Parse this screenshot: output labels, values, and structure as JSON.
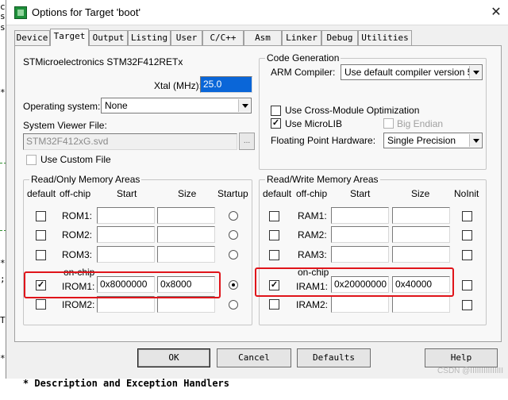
{
  "window": {
    "title": "Options for Target 'boot'",
    "close_glyph": "✕"
  },
  "tabs": [
    "Device",
    "Target",
    "Output",
    "Listing",
    "User",
    "C/C++",
    "Asm",
    "Linker",
    "Debug",
    "Utilities"
  ],
  "active_tab": "Target",
  "target": {
    "device_name": "STMicroelectronics STM32F412RETx",
    "xtal_label": "Xtal (MHz):",
    "xtal_value": "25.0",
    "os_label": "Operating system:",
    "os_value": "None",
    "svd_label": "System Viewer File:",
    "svd_value": "STM32F412xG.svd",
    "browse_label": "...",
    "custom_file_label": "Use Custom File"
  },
  "code_generation": {
    "title": "Code Generation",
    "compiler_label": "ARM Compiler:",
    "compiler_value": "Use default compiler version 5",
    "cross_module_label": "Use Cross-Module Optimization",
    "microlib_label": "Use MicroLIB",
    "big_endian_label": "Big Endian",
    "fpu_label": "Floating Point Hardware:",
    "fpu_value": "Single Precision"
  },
  "rom_areas": {
    "title": "Read/Only Memory Areas",
    "headers": {
      "default": "default",
      "offchip": "off-chip",
      "start": "Start",
      "size": "Size",
      "startup": "Startup"
    },
    "onchip_label": "on-chip",
    "rows": [
      {
        "name": "ROM1:",
        "start": "",
        "size": "",
        "checked": false,
        "startup": false
      },
      {
        "name": "ROM2:",
        "start": "",
        "size": "",
        "checked": false,
        "startup": false
      },
      {
        "name": "ROM3:",
        "start": "",
        "size": "",
        "checked": false,
        "startup": false
      },
      {
        "name": "IROM1:",
        "start": "0x8000000",
        "size": "0x8000",
        "checked": true,
        "startup": true
      },
      {
        "name": "IROM2:",
        "start": "",
        "size": "",
        "checked": false,
        "startup": false
      }
    ]
  },
  "ram_areas": {
    "title": "Read/Write Memory Areas",
    "headers": {
      "default": "default",
      "offchip": "off-chip",
      "start": "Start",
      "size": "Size",
      "noinit": "NoInit"
    },
    "onchip_label": "on-chip",
    "rows": [
      {
        "name": "RAM1:",
        "start": "",
        "size": "",
        "checked": false,
        "noinit": false
      },
      {
        "name": "RAM2:",
        "start": "",
        "size": "",
        "checked": false,
        "noinit": false
      },
      {
        "name": "RAM3:",
        "start": "",
        "size": "",
        "checked": false,
        "noinit": false
      },
      {
        "name": "IRAM1:",
        "start": "0x20000000",
        "size": "0x40000",
        "checked": true,
        "noinit": false
      },
      {
        "name": "IRAM2:",
        "start": "",
        "size": "",
        "checked": false,
        "noinit": false
      }
    ]
  },
  "buttons": {
    "ok": "OK",
    "cancel": "Cancel",
    "defaults": "Defaults",
    "help": "Help"
  },
  "watermark": "CSDN @IIIIIIIIIIIIIII",
  "background_code": [
    "c",
    "s",
    "s",
    "*",
    "*",
    ";",
    "T",
    "*",
    "* "
  ],
  "background_bottom_line": "Description and Exception Handlers",
  "colors": {
    "highlight_box": "#e0141a",
    "selection": "#0a66d8"
  }
}
